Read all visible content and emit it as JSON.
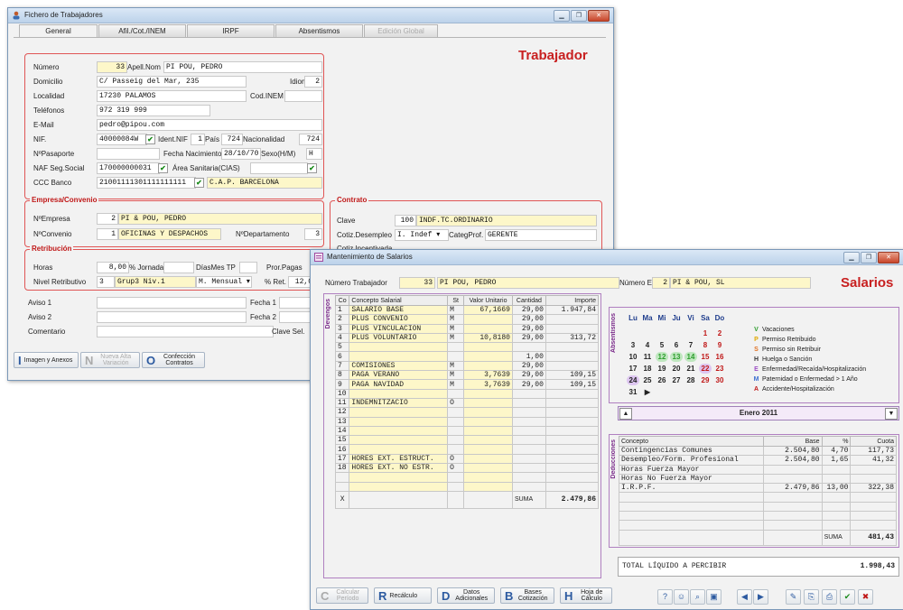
{
  "win1": {
    "title": "Fichero de Trabajadores",
    "tabs": [
      "General",
      "Afil./Cot./INEM",
      "IRPF",
      "Absentismos",
      "Edición Global"
    ],
    "heading": "Trabajador",
    "labels": {
      "numero": "Número",
      "apell_nom": "Apell.Nom",
      "domicilio": "Domicilio",
      "idioma": "Idioma",
      "localidad": "Localidad",
      "cod_inem": "Cod.INEM",
      "telefonos": "Teléfonos",
      "email": "E-Mail",
      "nif": "NIF.",
      "ident_nif": "Ident.NIF",
      "pais": "País",
      "nacionalidad": "Nacionalidad",
      "pasaporte": "NºPasaporte",
      "fecha_nac": "Fecha Nacimiento",
      "sexo": "Sexo(H/M)",
      "naf": "NAF Seg.Social",
      "area_sanitaria": "Área Sanitaria(CIAS)",
      "ccc_banco": "CCC Banco",
      "empresa_section": "Empresa/Convenio",
      "n_empresa": "NºEmpresa",
      "n_convenio": "NºConvenio",
      "n_departamento": "NºDepartamento",
      "retribucion_section": "Retribución",
      "horas": "Horas",
      "jornada": "% Jornada",
      "dias_mes": "DíasMes TP",
      "pror_pagas": "Pror.Pagas",
      "nivel_retrib": "Nivel Retributivo",
      "pct_ret": "% Ret.",
      "contrato_section": "Contrato",
      "clave": "Clave",
      "cotiz": "Cotiz.Desempleo",
      "categ": "CategProf.",
      "aviso1": "Aviso 1",
      "aviso2": "Aviso 2",
      "comentario": "Comentario",
      "fecha1": "Fecha 1",
      "fecha2": "Fecha 2",
      "clave_sel": "Clave Sel."
    },
    "values": {
      "numero": "33",
      "apell_nom": "PI POU, PEDRO",
      "domicilio": "C/ Passeig del Mar, 235",
      "idioma": "2",
      "localidad": "17230 PALAMOS",
      "telefonos": "972 319 999",
      "email": "pedro@pipou.com",
      "nif": "40000084W",
      "ident_nif": "1",
      "pais": "724",
      "nacionalidad": "724",
      "fecha_nac": "28/10/70",
      "sexo": "H",
      "naf": "170000000031",
      "ccc_banco": "21001111301111111111",
      "ccc_banco_name": "C.A.P. BARCELONA",
      "n_empresa": "2",
      "n_empresa_name": "PI & POU, PEDRO",
      "n_convenio": "1",
      "n_convenio_name": "OFICINAS Y DESPACHOS",
      "n_departamento": "3",
      "horas": "8,00",
      "nivel_retrib": "3",
      "nivel_retrib_name": "Grup3 Niv.1",
      "mensual": "M. Mensual",
      "pct_ret": "12,0",
      "clave": "100",
      "clave_name": "INDF.TC.ORDINARIO",
      "cotiz": "I. Indef",
      "categ": "GERENTE",
      "partial_row": "Cotiz.Incentivada"
    },
    "buttons": [
      {
        "letter": "I",
        "label": "Imagen y Anexos",
        "enabled": true
      },
      {
        "letter": "N",
        "label": "Nueva Alta Variación",
        "enabled": false
      },
      {
        "letter": "O",
        "label": "Confección Contratos",
        "enabled": true
      }
    ]
  },
  "win2": {
    "title": "Mantenimiento de Salarios",
    "heading": "Salarios",
    "numero_trabajador_label": "Número Trabajador",
    "numero_trabajador": "33",
    "trabajador_name": "PI POU, PEDRO",
    "numero_empresa_label": "Número Empresa",
    "numero_empresa": "2",
    "empresa_name": "PI & POU, SL",
    "devengos_label": "Devengos",
    "absentismos_label": "Absentismos",
    "deducciones_label": "Deducciones",
    "salary_headers": [
      "Co",
      "Concepto Salarial",
      "St",
      "Valor Unitario",
      "Cantidad",
      "Importe"
    ],
    "salary_rows": [
      [
        "1",
        "SALARIO BASE",
        "M",
        "67,1669",
        "29,00",
        "1.947,84"
      ],
      [
        "2",
        "PLUS CONVENIO",
        "M",
        "",
        "29,00",
        ""
      ],
      [
        "3",
        "PLUS VINCULACION",
        "M",
        "",
        "29,00",
        ""
      ],
      [
        "4",
        "PLUS VOLUNTARIO",
        "M",
        "10,8180",
        "29,00",
        "313,72"
      ],
      [
        "5",
        "",
        "",
        "",
        "",
        ""
      ],
      [
        "6",
        "",
        "",
        "",
        "1,00",
        ""
      ],
      [
        "7",
        "COMISIONES",
        "M",
        "",
        "29,00",
        ""
      ],
      [
        "8",
        "PAGA VERANO",
        "M",
        "3,7639",
        "29,00",
        "109,15"
      ],
      [
        "9",
        "PAGA NAVIDAD",
        "M",
        "3,7639",
        "29,00",
        "109,15"
      ],
      [
        "10",
        "",
        "",
        "",
        "",
        ""
      ],
      [
        "11",
        "INDEMNITZACIO",
        "O",
        "",
        "",
        ""
      ],
      [
        "12",
        "",
        "",
        "",
        "",
        ""
      ],
      [
        "13",
        "",
        "",
        "",
        "",
        ""
      ],
      [
        "14",
        "",
        "",
        "",
        "",
        ""
      ],
      [
        "15",
        "",
        "",
        "",
        "",
        ""
      ],
      [
        "16",
        "",
        "",
        "",
        "",
        ""
      ],
      [
        "17",
        "HORES EXT. ESTRUCT.",
        "O",
        "",
        "",
        ""
      ],
      [
        "18",
        "HORES EXT. NO ESTR.",
        "O",
        "",
        "",
        ""
      ],
      [
        "",
        "",
        "",
        "",
        "",
        ""
      ],
      [
        "",
        "",
        "",
        "",
        "",
        ""
      ]
    ],
    "salary_footer_x": "X",
    "salary_suma_label": "SUMA",
    "salary_suma": "2.479,86",
    "calendar": {
      "weekdays": [
        "Lu",
        "Ma",
        "Mi",
        "Ju",
        "Vi",
        "Sa",
        "Do"
      ],
      "weeks": [
        [
          "",
          "",
          "",
          "",
          "",
          "1",
          "2"
        ],
        [
          "3",
          "4",
          "5",
          "6",
          "7",
          "8",
          "9"
        ],
        [
          "10",
          "11",
          "12",
          "13",
          "14",
          "15",
          "16"
        ],
        [
          "17",
          "18",
          "19",
          "20",
          "21",
          "22",
          "23"
        ],
        [
          "24",
          "25",
          "26",
          "27",
          "28",
          "29",
          "30"
        ],
        [
          "31",
          "▶",
          "",
          "",
          "",
          "",
          ""
        ]
      ],
      "month": "Enero",
      "year": "2011",
      "colors": {
        "weekend": "#c01818",
        "vacation": "#2e9e2e",
        "highlight": "#b488d8"
      }
    },
    "legend": [
      {
        "code": "V",
        "label": "Vacaciones",
        "color": "#2e9e2e"
      },
      {
        "code": "P",
        "label": "Permiso Retribuido",
        "color": "#e0a800"
      },
      {
        "code": "S",
        "label": "Permiso sin Retribuir",
        "color": "#e07020"
      },
      {
        "code": "H",
        "label": "Huelga o Sanción",
        "color": "#333333"
      },
      {
        "code": "E",
        "label": "Enfermedad/Recaída/Hospitalización",
        "color": "#9b4bc4"
      },
      {
        "code": "M",
        "label": "Paternidad o Enfermedad > 1 Año",
        "color": "#3c6fd0"
      },
      {
        "code": "A",
        "label": "Accidente/Hospitalización",
        "color": "#c01818"
      }
    ],
    "deduction_headers": [
      "Concepto",
      "Base",
      "%",
      "Cuota"
    ],
    "deduction_rows": [
      [
        "Contingencias Comunes",
        "2.504,80",
        "4,70",
        "117,73"
      ],
      [
        "Desempleo/Form. Profesional",
        "2.504,80",
        "1,65",
        "41,32"
      ],
      [
        "Horas Fuerza Mayor",
        "",
        "",
        ""
      ],
      [
        "Horas No Fuerza Mayor",
        "",
        "",
        ""
      ],
      [
        "I.R.P.F.",
        "2.479,86",
        "13,00",
        "322,38"
      ],
      [
        "",
        "",
        "",
        ""
      ],
      [
        "",
        "",
        "",
        ""
      ],
      [
        "",
        "",
        "",
        ""
      ],
      [
        "",
        "",
        "",
        ""
      ]
    ],
    "deduction_suma_label": "SUMA",
    "deduction_suma": "481,43",
    "total_label": "TOTAL LÍQUIDO A PERCIBIR",
    "total_value": "1.998,43",
    "buttons": [
      {
        "letter": "C",
        "label": "Calcular Período",
        "enabled": false
      },
      {
        "letter": "R",
        "label": "Recálculo",
        "enabled": true
      },
      {
        "letter": "D",
        "label": "Datos Adicionales",
        "enabled": true
      },
      {
        "letter": "B",
        "label": "Bases Cotización",
        "enabled": true
      },
      {
        "letter": "H",
        "label": "Hoja de Cálculo",
        "enabled": true
      }
    ],
    "toolbar_icons": [
      {
        "name": "help-icon",
        "glyph": "?"
      },
      {
        "name": "users-icon",
        "glyph": "☺"
      },
      {
        "name": "zoom-icon",
        "glyph": "⌕"
      },
      {
        "name": "save-icon",
        "glyph": "▣"
      },
      {
        "name": "prev-icon",
        "glyph": "◀"
      },
      {
        "name": "next-icon",
        "glyph": "▶"
      },
      {
        "name": "edit-icon",
        "glyph": "✎"
      },
      {
        "name": "copy-icon",
        "glyph": "⎘"
      },
      {
        "name": "print-icon",
        "glyph": "⎙"
      },
      {
        "name": "accept-icon",
        "glyph": "✔"
      },
      {
        "name": "exit-icon",
        "glyph": "✖"
      }
    ]
  }
}
